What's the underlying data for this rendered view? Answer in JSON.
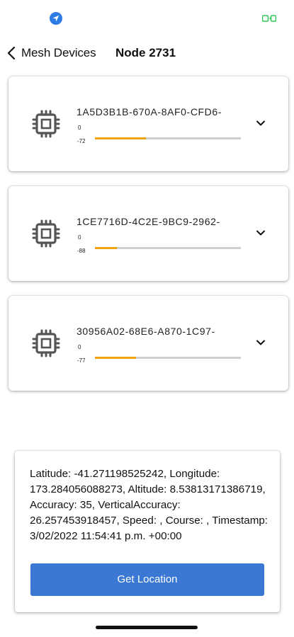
{
  "status_bar": {
    "left_icon": "location-arrow-icon",
    "right_icon": "camera-icon",
    "location_color": "#2f7be5",
    "camera_color": "#34c759"
  },
  "nav": {
    "back_label": "Mesh Devices",
    "title": "Node 2731"
  },
  "devices": [
    {
      "id": "1A5D3B1B-670A-8AF0-CFD6-",
      "rssi_max": "0",
      "rssi": "-72",
      "signal_fraction": 0.35
    },
    {
      "id": "1CE7716D-4C2E-9BC9-2962-",
      "rssi_max": "0",
      "rssi": "-88",
      "signal_fraction": 0.15
    },
    {
      "id": "30956A02-68E6-A870-1C97-",
      "rssi_max": "0",
      "rssi": "-77",
      "signal_fraction": 0.28
    }
  ],
  "location": {
    "text": "Latitude: -41.271198525242, Longitude: 173.284056088273, Altitude: 8.53813171386719, Accuracy: 35, VerticalAccuracy: 26.257453918457, Speed: , Course: , Timestamp: 3/02/2022 11:54:41 p.m. +00:00",
    "button_label": "Get Location"
  },
  "colors": {
    "accent": "#3a78d4",
    "signal": "#f0a30a",
    "track": "#cfcfcf",
    "icon": "#555555"
  },
  "icons": {
    "device": "chip-icon",
    "expand": "chevron-down-icon",
    "back": "chevron-left-icon"
  }
}
